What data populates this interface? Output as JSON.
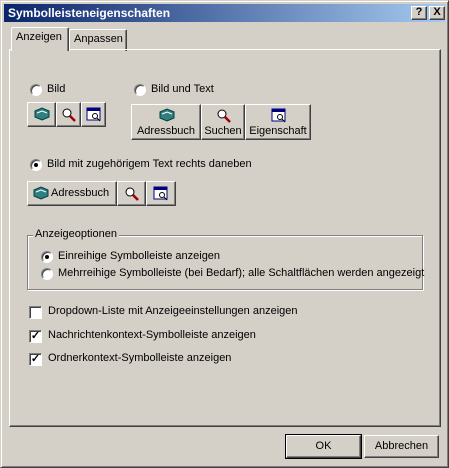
{
  "window": {
    "title": "Symbolleisteneigenschaften",
    "help_button": "?",
    "close_button": "X",
    "titlebar_color": "#0a246a"
  },
  "tabs": [
    {
      "label": "Anzeigen",
      "active": true
    },
    {
      "label": "Anpassen",
      "active": false
    }
  ],
  "display_mode": {
    "option_picture": "Bild",
    "option_picture_text": "Bild und Text",
    "option_picture_text_right": "Bild mit zugehörigem Text rechts daneben",
    "selected": "option_picture_text_right",
    "preview_text_buttons": [
      "Adressbuch",
      "Suchen",
      "Eigenschaft"
    ],
    "preview_right_button": "Adressbuch"
  },
  "display_options": {
    "legend": "Anzeigeoptionen",
    "single_row": "Einreihige Symbolleiste anzeigen",
    "multi_row": "Mehrreihige Symbolleiste (bei Bedarf); alle Schaltflächen werden angezeigt",
    "selected": "single_row"
  },
  "checkboxes": [
    {
      "label": "Dropdown-Liste mit Anzeigeeinstellungen anzeigen",
      "checked": false
    },
    {
      "label": "Nachrichtenkontext-Symbolleiste anzeigen",
      "checked": true
    },
    {
      "label": "Ordnerkontext-Symbolleiste anzeigen",
      "checked": true
    }
  ],
  "footer": {
    "ok": "OK",
    "cancel": "Abbrechen"
  },
  "icons": {
    "addressbook": "addressbook-icon",
    "search": "magnifier-icon",
    "properties": "properties-icon"
  }
}
